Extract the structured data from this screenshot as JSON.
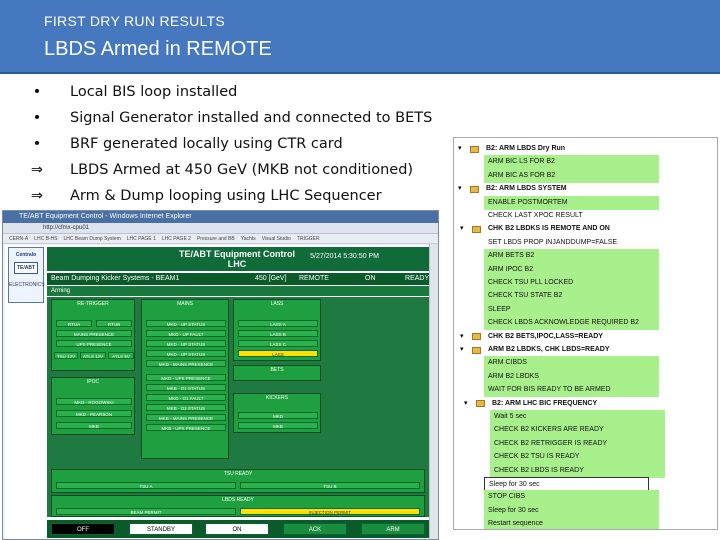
{
  "slide": {
    "kicker": "FIRST DRY RUN RESULTS",
    "title": "LBDS Armed in REMOTE",
    "bullets": [
      {
        "marker": "•",
        "text": "Local BIS loop installed"
      },
      {
        "marker": "•",
        "text": "Signal Generator installed and connected to BETS"
      },
      {
        "marker": "•",
        "text": "BRF generated locally using CTR card"
      },
      {
        "marker": "⇒",
        "text": "LBDS Armed at 450 GeV (MKB not conditioned)"
      },
      {
        "marker": "⇒",
        "text": "Arm & Dump looping using LHC Sequencer"
      }
    ]
  },
  "control": {
    "window_title": "TE/ABT Equipment Control - Windows Internet Explorer",
    "url": "http://cfmx-cpu01",
    "tabs": [
      "CERN-A",
      "LHC B-HS",
      "LHC Beam Dump System",
      "LHC PAGE 1",
      "LHC PAGE 2",
      "Pressure and BB",
      "Yachts",
      "Visual Studio",
      "TRIGGER"
    ],
    "logo": {
      "org": "Centralo",
      "badge": "TE/ABT",
      "division": "ELECTRONICS"
    },
    "header_title": "TE/ABT Equipment Control LHC",
    "timestamp": "5/27/2014  5:30:50 PM",
    "subheader": "Beam Dumping Kicker Systems - BEAM1",
    "energy": "450 [GeV]",
    "mode": "REMOTE",
    "state_on": "ON",
    "state_ready": "READY",
    "status": "Arming",
    "groups": {
      "retrigger": {
        "title": "RE-TRIGGER",
        "rows": [
          "RTUA",
          "RTUB",
          "MAINS PRESENCE",
          "UPS PRESENCE",
          "TSU 12V",
          "ATLS 12V",
          "ATLS 5V"
        ]
      },
      "mains": {
        "title": "MAINS",
        "rows": [
          "MKD - UP STATUS",
          "MKD - UP FAULT",
          "MKD - UP STATUS",
          "MKD - UP STATUS",
          "MKD - MAINS PRESENCE",
          "MKD - UPS PRESENCE",
          "MKB - Q1 STATUS",
          "MKD - Q1 FAULT",
          "MKB - Q2 STATUS",
          "MKB - MAINS PRESENCE",
          "MKB - UPS PRESENCE"
        ]
      },
      "lass": {
        "title": "LASS",
        "rows": [
          "LASS A",
          "LASS B",
          "LASS C",
          "LASS"
        ]
      },
      "bets": {
        "title": "BETS"
      },
      "kickers": {
        "title": "KICKERS",
        "rows": [
          "MKD",
          "MKB"
        ]
      },
      "ipoc": {
        "title": "IPOC",
        "rows": [
          "MKD - ROGOWSKI",
          "MKD - PEARSON",
          "MKB"
        ]
      },
      "tsu": {
        "title": "TSU READY",
        "rows": [
          "TSU A",
          "TSU B"
        ]
      },
      "lbds": {
        "title": "LBDS READY",
        "rows": [
          "BEAM PERMIT",
          "INJECTION PERMIT"
        ]
      }
    },
    "buttons": [
      "OFF",
      "STANDBY",
      "ON",
      "ACK",
      "ARM"
    ]
  },
  "sequencer": [
    {
      "text": "B2: ARM LBDS Dry Run",
      "bold": true,
      "green": false,
      "icon": "folder-icon"
    },
    {
      "text": "ARM BIC LS FOR B2",
      "green": true
    },
    {
      "text": "ARM BIC AS FOR B2",
      "green": true
    },
    {
      "text": "B2: ARM LBDS SYSTEM",
      "bold": true,
      "green": false,
      "icon": "folder-icon"
    },
    {
      "text": "ENABLE POSTMORTEM",
      "green": true
    },
    {
      "text": "CHECK LAST XPOC RESULT",
      "green": false
    },
    {
      "text": "CHK B2 LBDKS IS REMOTE AND ON",
      "bold": true,
      "green": false,
      "icon": "folder-icon"
    },
    {
      "text": "SET LBDS PROP INJANDDUMP=FALSE",
      "green": false
    },
    {
      "text": "ARM BETS B2",
      "green": true
    },
    {
      "text": "ARM IPOC B2",
      "green": true
    },
    {
      "text": "CHECK TSU PLL LOCKED",
      "green": true
    },
    {
      "text": "CHECK TSU STATE B2",
      "green": true
    },
    {
      "text": "SLEEP",
      "green": true
    },
    {
      "text": "CHECK LBDS ACKNOWLEDGE REQUIRED B2",
      "green": true
    },
    {
      "text": "CHK B2 BETS,IPOC,LASS=READY",
      "bold": true,
      "green": false,
      "icon": "folder-icon"
    },
    {
      "text": "ARM B2 LBDKS, CHK LBDS=READY",
      "bold": true,
      "green": false,
      "icon": "folder-icon"
    },
    {
      "text": "ARM CIBDS",
      "green": true
    },
    {
      "text": "ARM B2 LBDKS",
      "green": true
    },
    {
      "text": "WAIT FOR BIS READY TO BE ARMED",
      "green": true
    },
    {
      "text": "B2: ARM LHC BIC FREQUENCY",
      "bold": true,
      "green": false,
      "icon": "folder-icon"
    },
    {
      "text": "Wait 5 sec",
      "green": true
    },
    {
      "text": "CHECK B2 KICKERS ARE READY",
      "green": true
    },
    {
      "text": "CHECK B2 RETRIGGER IS READY",
      "green": true
    },
    {
      "text": "CHECK B2 TSU IS READY",
      "green": true
    },
    {
      "text": "CHECK B2 LBDS IS READY",
      "green": true
    },
    {
      "text": "Sleep for 30 sec",
      "green": false,
      "selected": true
    },
    {
      "text": "STOP CIBS",
      "green": true
    },
    {
      "text": "Sleep for 30 sec",
      "green": true
    },
    {
      "text": "Restart sequence",
      "green": true
    }
  ]
}
